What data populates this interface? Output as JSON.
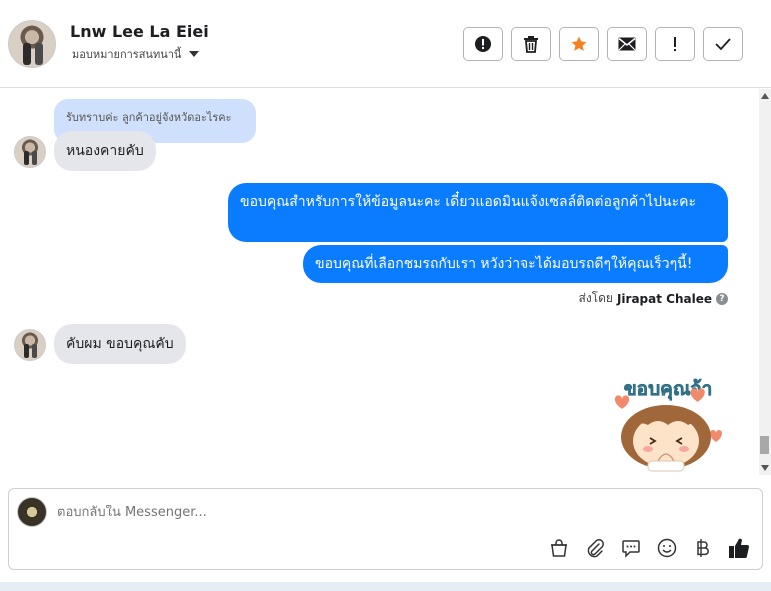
{
  "header": {
    "contact_name": "Lnw Lee La Eiei",
    "contact_sub": "มอบหมายการสนทนานี้"
  },
  "toolbar": {
    "buttons": [
      "report",
      "delete",
      "star",
      "mail",
      "important",
      "done"
    ]
  },
  "chat": {
    "quoted_text": "รับทราบค่ะ ลูกค้าอยู่จังหวัดอะไรคะ",
    "incoming_1": "หนองคายคับ",
    "outgoing_1": "ขอบคุณสำหรับการให้ข้อมูลนะคะ เดี๋ยวแอดมินแจ้งเซลล์ติดต่อลูกค้าไปนะคะ",
    "outgoing_2": "ขอบคุณที่เลือกชมรถกับเรา หวังว่าจะได้มอบรถดีๆให้คุณเร็วๆนี้!",
    "sent_by_prefix": "ส่งโดย",
    "sent_by_name": "Jirapat Chalee",
    "incoming_2": "คับผม ขอบคุณคับ",
    "sticker_text": "ขอบคุณจ้า"
  },
  "composer": {
    "placeholder": "ตอบกลับใน Messenger..."
  },
  "colors": {
    "outgoing_bubble": "#0a7cff",
    "incoming_bubble": "#e4e6eb",
    "quoted_bubble": "#cfe0fc",
    "star": "#f5821f"
  }
}
